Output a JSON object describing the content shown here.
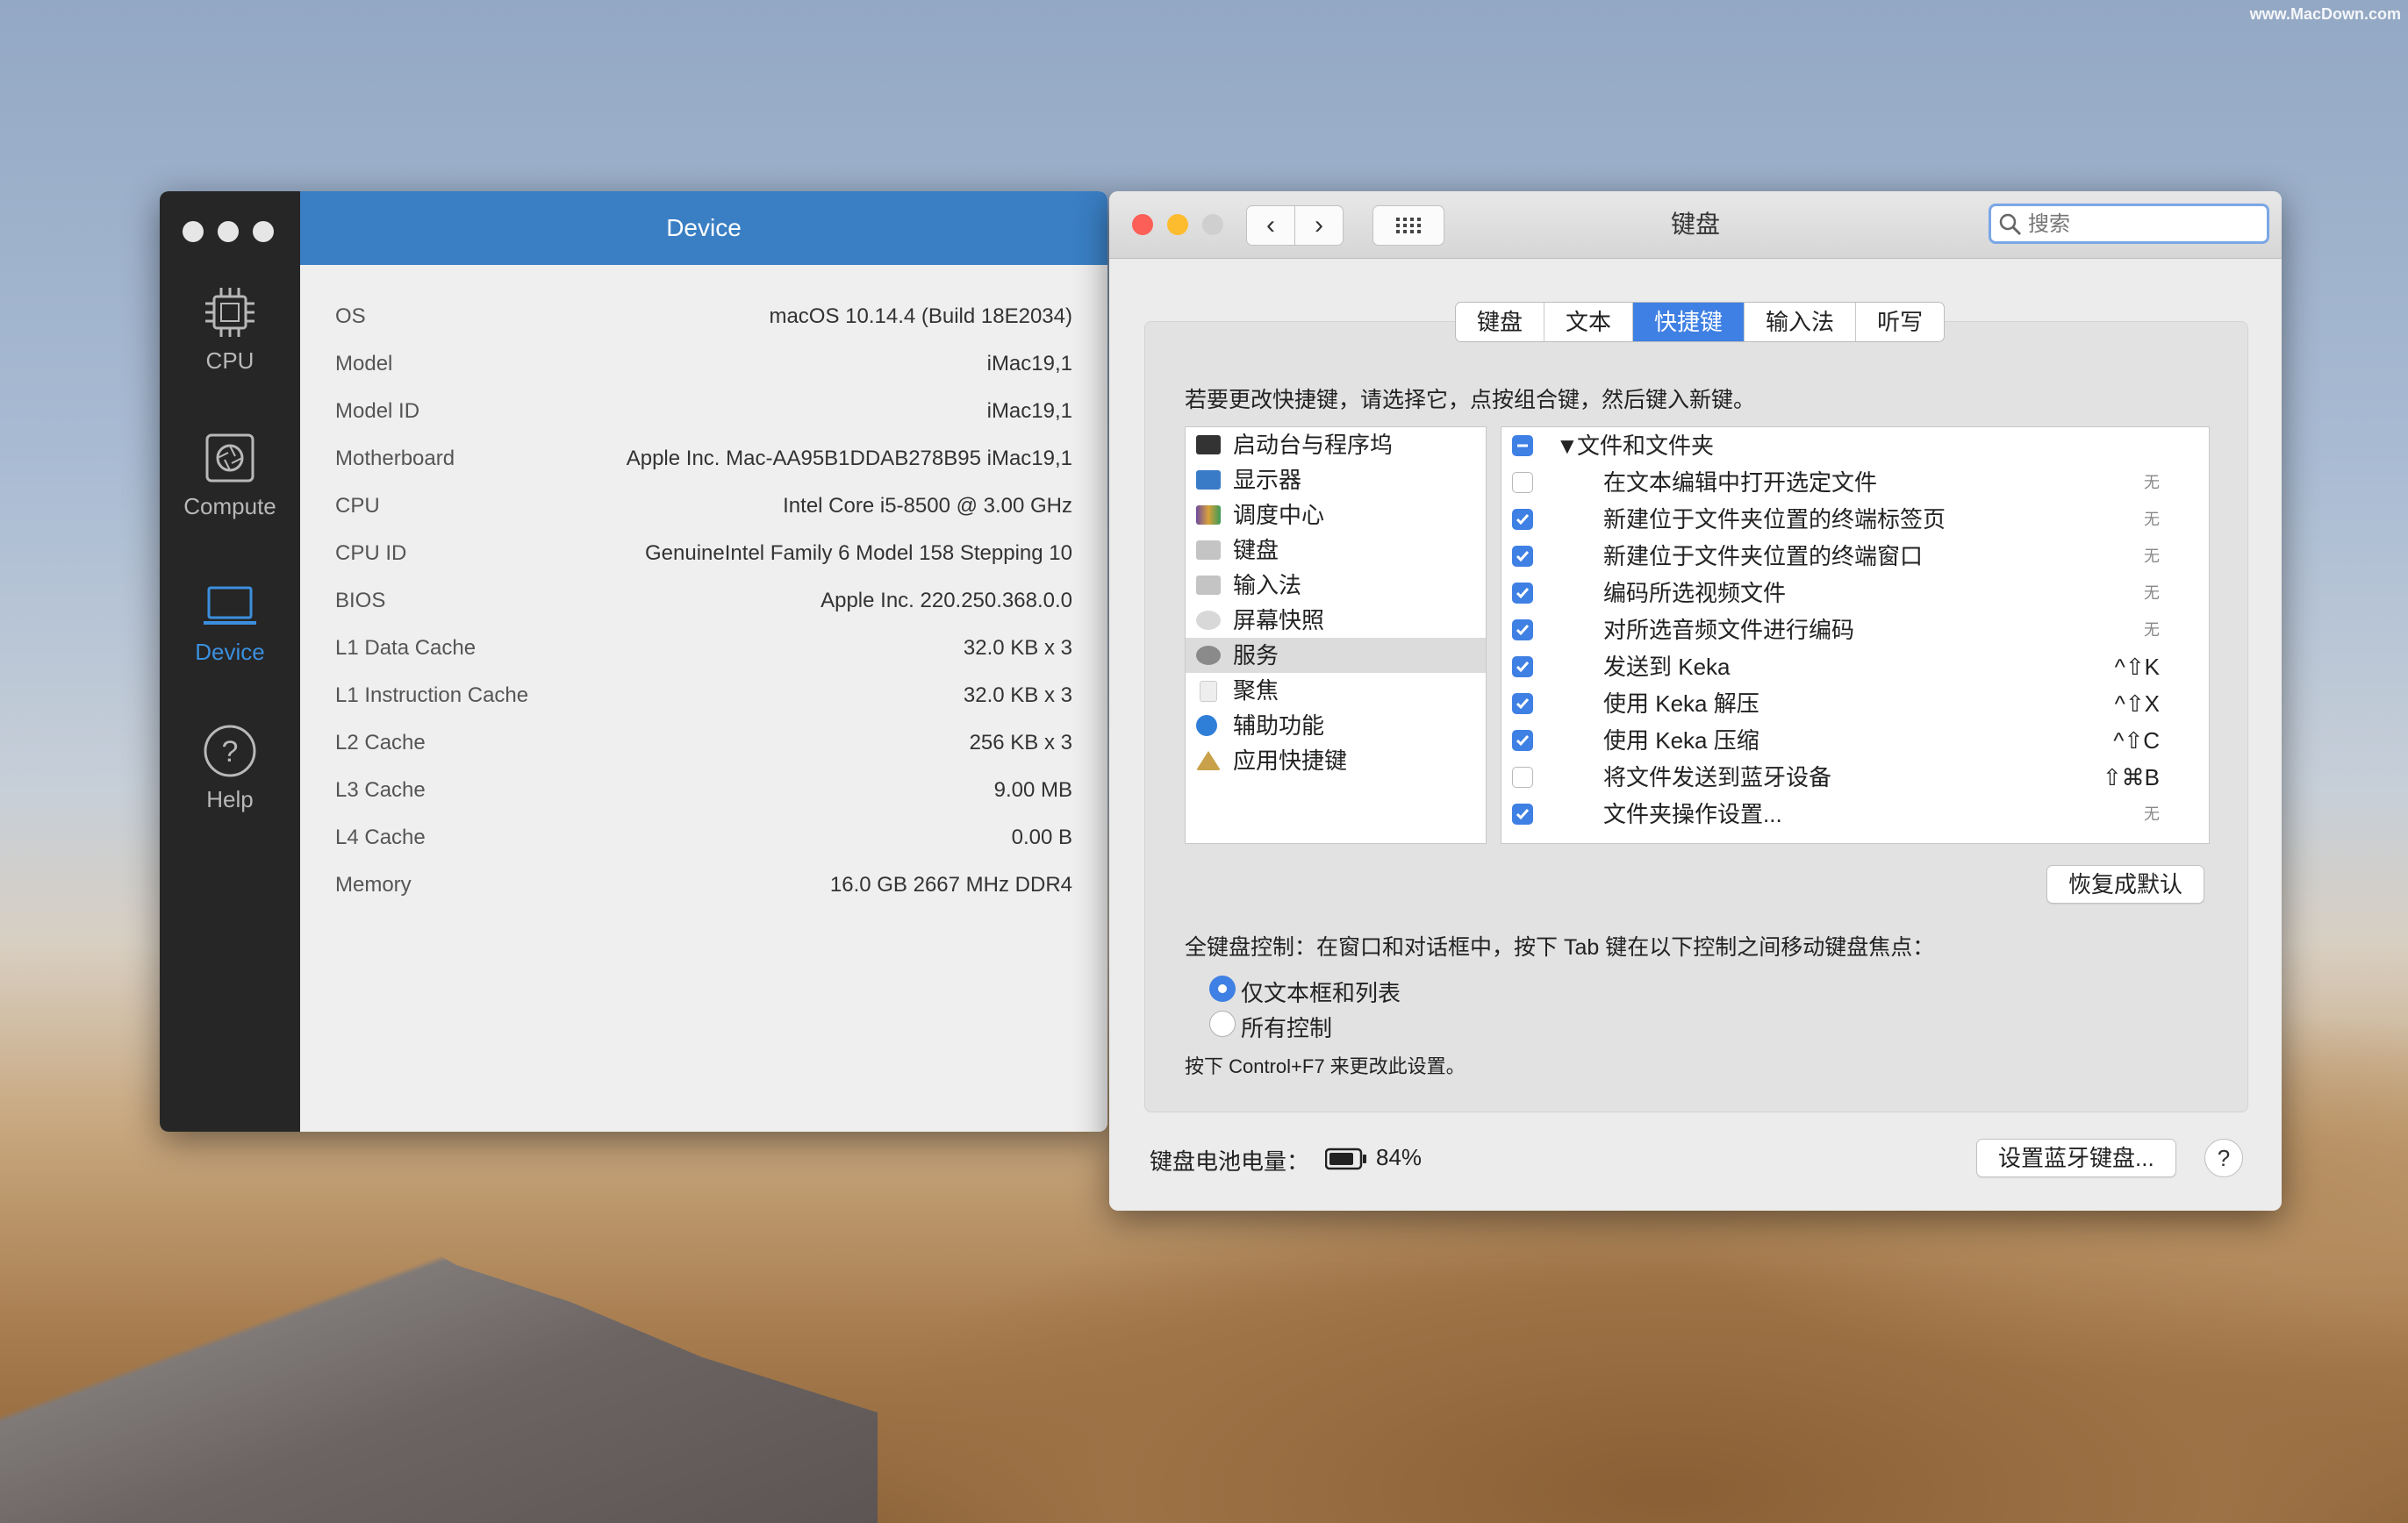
{
  "watermark": "www.MacDown.com",
  "left_window": {
    "header_title": "Device",
    "nav": [
      {
        "label": "CPU",
        "icon": "cpu-icon"
      },
      {
        "label": "Compute",
        "icon": "compute-icon"
      },
      {
        "label": "Device",
        "icon": "laptop-icon",
        "active": true
      },
      {
        "label": "Help",
        "icon": "help-icon"
      }
    ],
    "rows": [
      {
        "key": "OS",
        "value": "macOS 10.14.4 (Build 18E2034)"
      },
      {
        "key": "Model",
        "value": "iMac19,1"
      },
      {
        "key": "Model ID",
        "value": "iMac19,1"
      },
      {
        "key": "Motherboard",
        "value": "Apple Inc. Mac-AA95B1DDAB278B95 iMac19,1"
      },
      {
        "key": "CPU",
        "value": "Intel Core i5-8500 @ 3.00 GHz"
      },
      {
        "key": "CPU ID",
        "value": "GenuineIntel Family 6 Model 158 Stepping 10"
      },
      {
        "key": "BIOS",
        "value": "Apple Inc. 220.250.368.0.0"
      },
      {
        "key": "L1 Data Cache",
        "value": "32.0 KB x 3"
      },
      {
        "key": "L1 Instruction Cache",
        "value": "32.0 KB x 3"
      },
      {
        "key": "L2 Cache",
        "value": "256 KB x 3"
      },
      {
        "key": "L3 Cache",
        "value": "9.00 MB"
      },
      {
        "key": "L4 Cache",
        "value": "0.00 B"
      },
      {
        "key": "Memory",
        "value": "16.0 GB 2667 MHz DDR4"
      }
    ]
  },
  "right_window": {
    "title": "键盘",
    "search_placeholder": "搜索",
    "tabs": [
      {
        "label": "键盘"
      },
      {
        "label": "文本"
      },
      {
        "label": "快捷键",
        "active": true
      },
      {
        "label": "输入法"
      },
      {
        "label": "听写"
      }
    ],
    "instruction": "若要更改快捷键，请选择它，点按组合键，然后键入新键。",
    "categories": [
      {
        "label": "启动台与程序坞",
        "color": "#333333"
      },
      {
        "label": "显示器",
        "color": "#3a7bc8"
      },
      {
        "label": "调度中心",
        "color": "#6b4aa0"
      },
      {
        "label": "键盘",
        "color": "#bdbdbd"
      },
      {
        "label": "输入法",
        "color": "#bdbdbd"
      },
      {
        "label": "屏幕快照",
        "color": "#d0d0d0"
      },
      {
        "label": "服务",
        "color": "#8a8a8a",
        "selected": true
      },
      {
        "label": "聚焦",
        "color": "#e4e4e4"
      },
      {
        "label": "辅助功能",
        "color": "#2f7fd8"
      },
      {
        "label": "应用快捷键",
        "color": "#c9a14a"
      }
    ],
    "services": [
      {
        "label": "文件和文件夹",
        "state": "mixed",
        "group": true,
        "shortcut": ""
      },
      {
        "label": "在文本编辑中打开选定文件",
        "state": "off",
        "shortcut": "无"
      },
      {
        "label": "新建位于文件夹位置的终端标签页",
        "state": "on",
        "shortcut": "无"
      },
      {
        "label": "新建位于文件夹位置的终端窗口",
        "state": "on",
        "shortcut": "无"
      },
      {
        "label": "编码所选视频文件",
        "state": "on",
        "shortcut": "无"
      },
      {
        "label": "对所选音频文件进行编码",
        "state": "on",
        "shortcut": "无"
      },
      {
        "label": "发送到 Keka",
        "state": "on",
        "shortcut": "^⇧K"
      },
      {
        "label": "使用 Keka 解压",
        "state": "on",
        "shortcut": "^⇧X"
      },
      {
        "label": "使用 Keka 压缩",
        "state": "on",
        "shortcut": "^⇧C"
      },
      {
        "label": "将文件发送到蓝牙设备",
        "state": "off",
        "shortcut": "⇧⌘B"
      },
      {
        "label": "文件夹操作设置...",
        "state": "on",
        "shortcut": "无"
      }
    ],
    "restore_button": "恢复成默认",
    "full_keyboard_text": "全键盘控制：在窗口和对话框中，按下 Tab 键在以下控制之间移动键盘焦点：",
    "radio_options": [
      {
        "label": "仅文本框和列表",
        "selected": true
      },
      {
        "label": "所有控制",
        "selected": false
      }
    ],
    "note": "按下 Control+F7 来更改此设置。",
    "battery_label": "键盘电池电量：",
    "battery_percent": "84%",
    "battery_level": 0.84,
    "bluetooth_button": "设置蓝牙键盘...",
    "help_label": "?"
  }
}
